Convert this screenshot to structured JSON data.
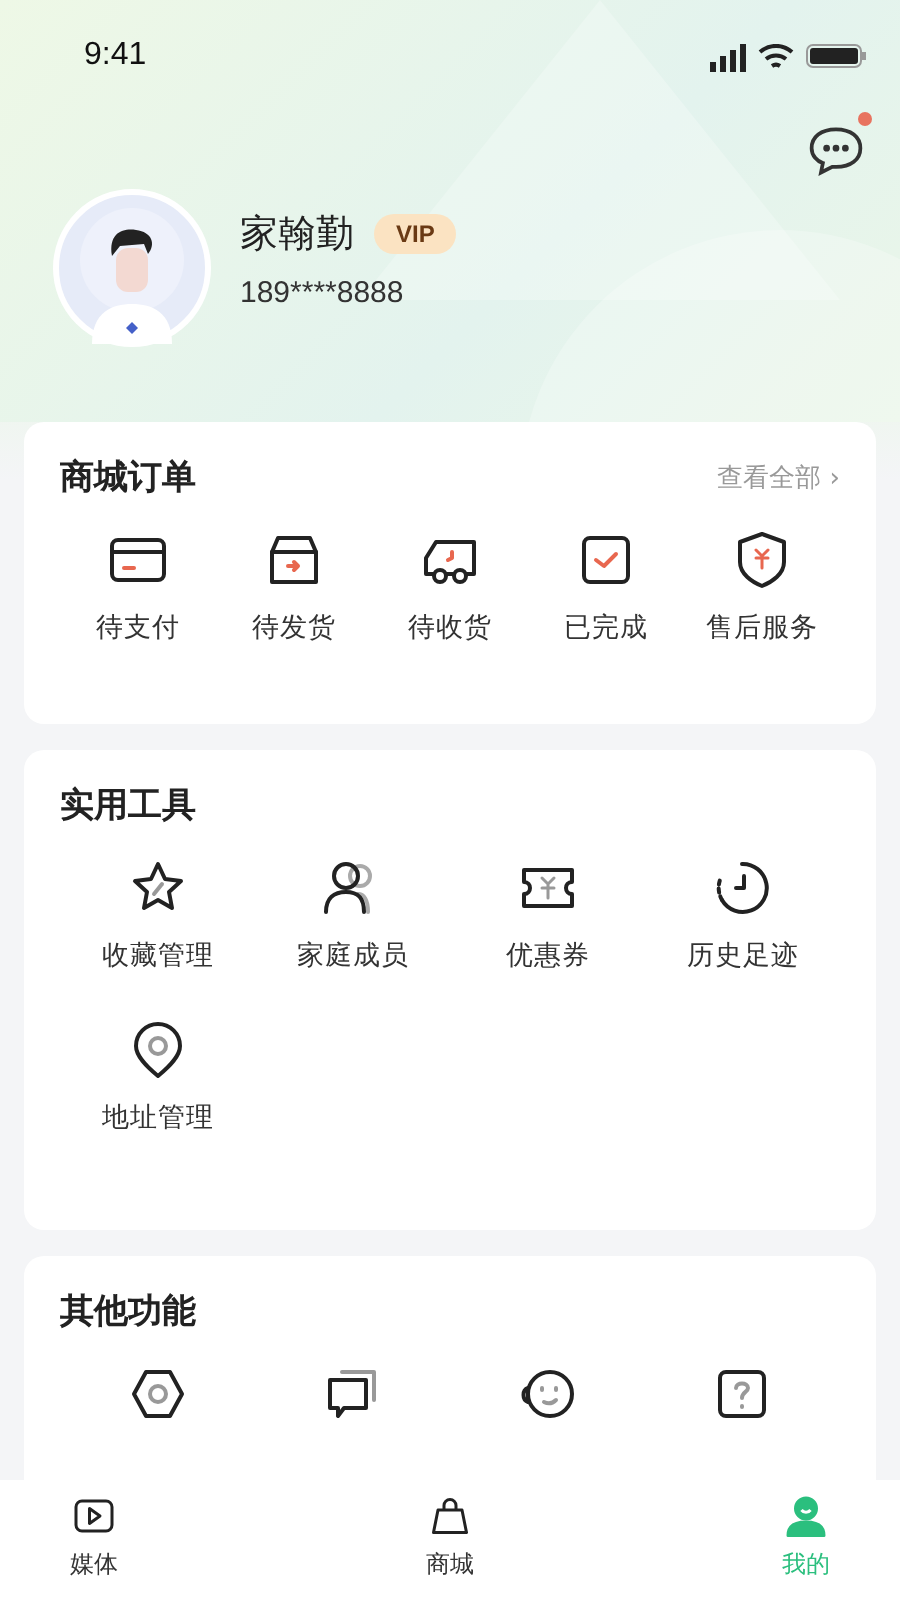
{
  "status_bar": {
    "time": "9:41"
  },
  "messages": {
    "unread": true
  },
  "profile": {
    "name": "家翰勤",
    "badge": "VIP",
    "phone": "189****8888"
  },
  "orders": {
    "title": "商城订单",
    "link": "查看全部 ›",
    "items": [
      {
        "label": "待支付"
      },
      {
        "label": "待发货"
      },
      {
        "label": "待收货"
      },
      {
        "label": "已完成"
      },
      {
        "label": "售后服务"
      }
    ]
  },
  "tools": {
    "title": "实用工具",
    "items": [
      {
        "label": "收藏管理"
      },
      {
        "label": "家庭成员"
      },
      {
        "label": "优惠券"
      },
      {
        "label": "历史足迹"
      },
      {
        "label": "地址管理"
      }
    ]
  },
  "other": {
    "title": "其他功能",
    "items": [
      {
        "kind": "settings"
      },
      {
        "kind": "feedback"
      },
      {
        "kind": "support"
      },
      {
        "kind": "help"
      }
    ]
  },
  "tab_bar": [
    {
      "label": "媒体",
      "selected": false
    },
    {
      "label": "商城",
      "selected": false
    },
    {
      "label": "我的",
      "selected": true
    }
  ]
}
